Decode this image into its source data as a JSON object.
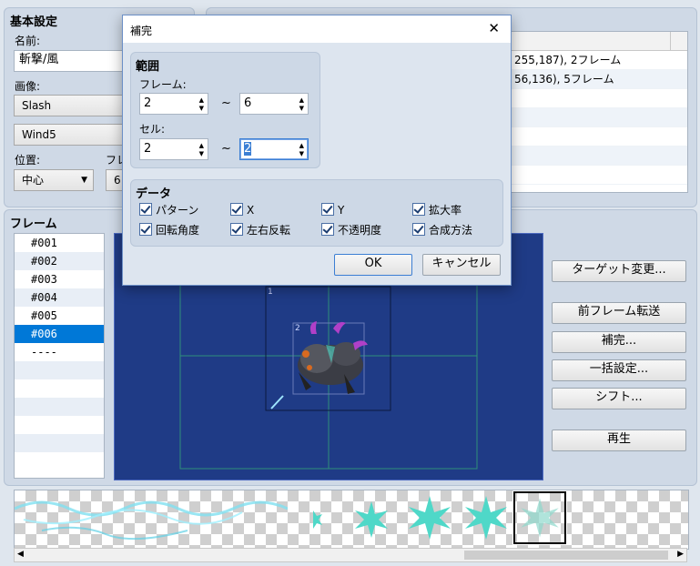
{
  "basic": {
    "title": "基本設定",
    "name_label": "名前:",
    "name_value": "斬撃/風",
    "image_label": "画像:",
    "image1": "Slash",
    "image2": "Wind5",
    "position_label": "位置:",
    "position_value": "中心",
    "frames_label_partial": "フレ",
    "frames_value_partial": "6"
  },
  "timing": {
    "rows": [
      "255,187), 2フレーム",
      "56,136), 5フレーム"
    ]
  },
  "frames": {
    "title": "フレーム",
    "items": [
      "#001",
      "#002",
      "#003",
      "#004",
      "#005",
      "#006",
      "----"
    ],
    "selected_index": 5
  },
  "canvas": {
    "cell_labels": [
      "1",
      "2"
    ]
  },
  "side_buttons": {
    "target_change": "ターゲット変更...",
    "prev_frame_copy": "前フレーム転送",
    "tween": "補完...",
    "batch": "一括設定...",
    "shift": "シフト...",
    "play": "再生"
  },
  "dialog": {
    "title": "補完",
    "close": "✕",
    "range_title": "範囲",
    "frame_label": "フレーム:",
    "frame_from": "2",
    "frame_to": "6",
    "cell_label": "セル:",
    "cell_from": "2",
    "cell_to": "2",
    "tilde": "~",
    "data_title": "データ",
    "checks": [
      "パターン",
      "X",
      "Y",
      "拡大率",
      "回転角度",
      "左右反転",
      "不透明度",
      "合成方法"
    ],
    "ok": "OK",
    "cancel": "キャンセル"
  },
  "icons": {
    "spin_up": "spin-up-icon",
    "spin_down": "spin-down-icon",
    "dropdown": "chevron-down-icon",
    "scroll_left": "scroll-left-icon",
    "scroll_right": "scroll-right-icon"
  },
  "colors": {
    "canvas_bg": "#1f3b86",
    "selection": "#0078d7",
    "panel": "#cfd9e6"
  }
}
